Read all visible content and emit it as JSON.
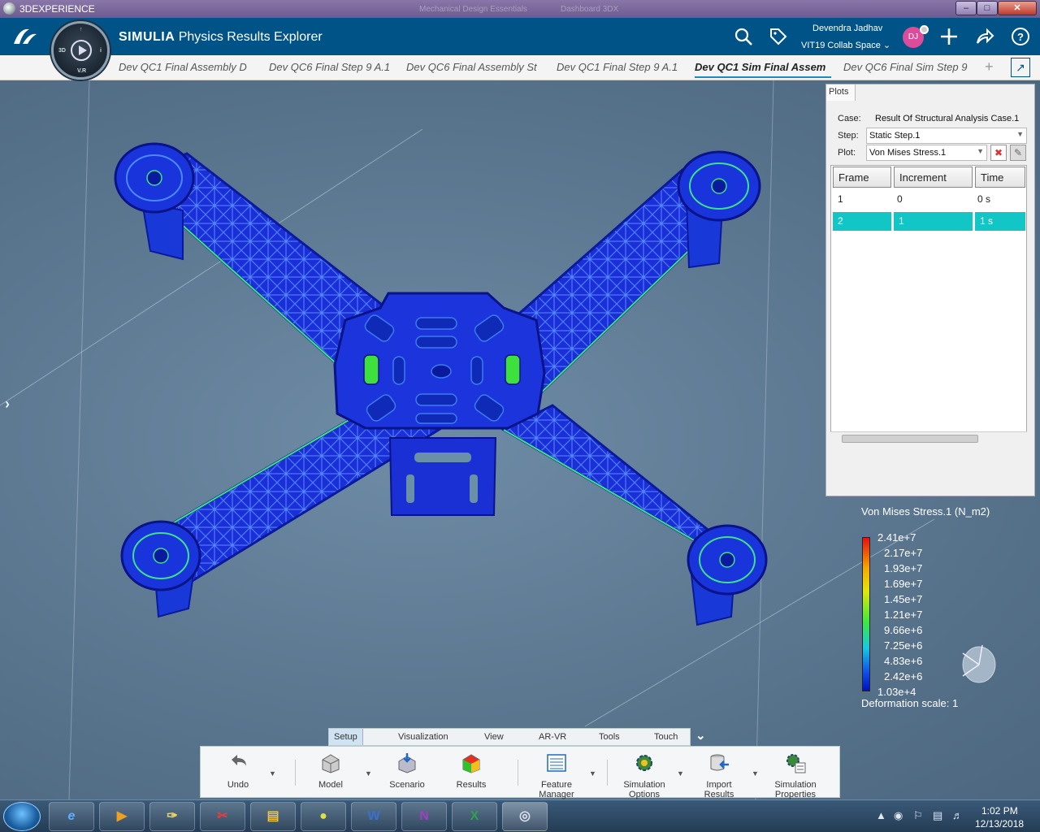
{
  "window": {
    "title": "3DEXPERIENCE",
    "center_text": "Mechanical Design Essentials",
    "center_text2": "Dashboard 3DX",
    "min_label": "–",
    "max_label": "□",
    "close_label": "✕"
  },
  "header": {
    "brand": "SIMULIA",
    "app_name": "Physics Results Explorer",
    "user_name": "Devendra Jadhav",
    "collab_space": "VIT19 Collab Space",
    "avatar_initials": "DJ",
    "icons": [
      "search-icon",
      "tag-icon",
      "add-icon",
      "share-icon",
      "help-icon"
    ],
    "compass_labels": [
      "3D",
      "V.R",
      "i",
      "↑"
    ]
  },
  "tabs": [
    {
      "label": "Dev QC1 Final Assembly D"
    },
    {
      "label": "Dev QC6 Final Step 9 A.1"
    },
    {
      "label": "Dev QC6 Final Assembly St"
    },
    {
      "label": "Dev QC1 Final Step 9 A.1"
    },
    {
      "label": "Dev QC1 Sim Final Assem",
      "active": true
    },
    {
      "label": "Dev QC6 Final Sim Step 9"
    }
  ],
  "tab_add_label": "+",
  "plots": {
    "tab_label": "Plots",
    "case_label": "Case:",
    "case_value": "Result Of Structural Analysis Case.1",
    "step_label": "Step:",
    "step_value": "Static Step.1",
    "plot_label": "Plot:",
    "plot_value": "Von Mises Stress.1",
    "columns": [
      "Frame",
      "Increment",
      "Time"
    ],
    "rows": [
      [
        "1",
        "0",
        "0 s"
      ],
      [
        "2",
        "1",
        "1 s"
      ]
    ],
    "selected_row": 1
  },
  "legend": {
    "title": "Von Mises Stress.1 (N_m2)",
    "values": [
      "2.41e+7",
      "2.17e+7",
      "1.93e+7",
      "1.69e+7",
      "1.45e+7",
      "1.21e+7",
      "9.66e+6",
      "7.25e+6",
      "4.83e+6",
      "2.42e+6",
      "1.03e+4"
    ],
    "deformation": "Deformation scale: 1",
    "colors": {
      "max": "#e81010",
      "mid": "#3ee83e",
      "min": "#0010c0"
    }
  },
  "section_tabs": [
    "Setup",
    "Visualization",
    "View",
    "AR-VR",
    "Tools",
    "Touch"
  ],
  "active_section": "Setup",
  "actions": {
    "undo": "Undo",
    "model": "Model",
    "scenario": "Scenario",
    "results": "Results",
    "feature_manager": [
      "Feature",
      "Manager"
    ],
    "simulation_options": [
      "Simulation",
      "Options"
    ],
    "import_results": [
      "Import",
      "Results"
    ],
    "simulation_properties": [
      "Simulation",
      "Properties"
    ]
  },
  "taskbar": {
    "apps": [
      "internet-explorer",
      "media-player",
      "paint",
      "snipping-tool",
      "file-explorer",
      "chrome",
      "word",
      "onenote",
      "excel",
      "3dexperience"
    ],
    "app_labels": [
      "e",
      "▶",
      "✑",
      "✂",
      "▤",
      "●",
      "W",
      "N",
      "X",
      "◎"
    ],
    "time": "1:02 PM",
    "date": "12/13/2018"
  },
  "colors": {
    "header_bg": "#005386",
    "accent": "#1d8ac6",
    "selected_row": "#12c6c6",
    "model_blue": "#1a2fd8"
  }
}
